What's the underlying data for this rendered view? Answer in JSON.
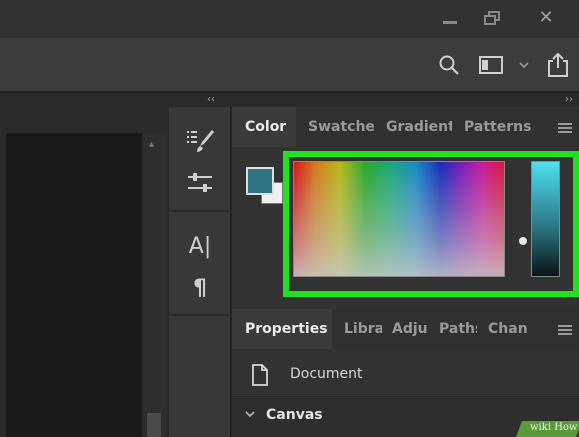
{
  "window": {
    "close_glyph": "✕"
  },
  "panel_collapse": {
    "left_glyph": "‹‹",
    "right_glyph": "››"
  },
  "tools": {
    "text_glyph": "A|",
    "paragraph_glyph": "¶"
  },
  "color_panel": {
    "tabs": [
      "Color",
      "Swatches",
      "Gradients",
      "Patterns"
    ],
    "foreground_color": "#2f7483",
    "background_color": "#f0f0f0",
    "highlight_color": "#22e022"
  },
  "properties_panel": {
    "tabs": [
      "Properties",
      "Libra",
      "Adju",
      "Paths",
      "Chan"
    ],
    "document_label": "Document",
    "section_label": "Canvas"
  },
  "watermark": {
    "text": "wiki How"
  }
}
